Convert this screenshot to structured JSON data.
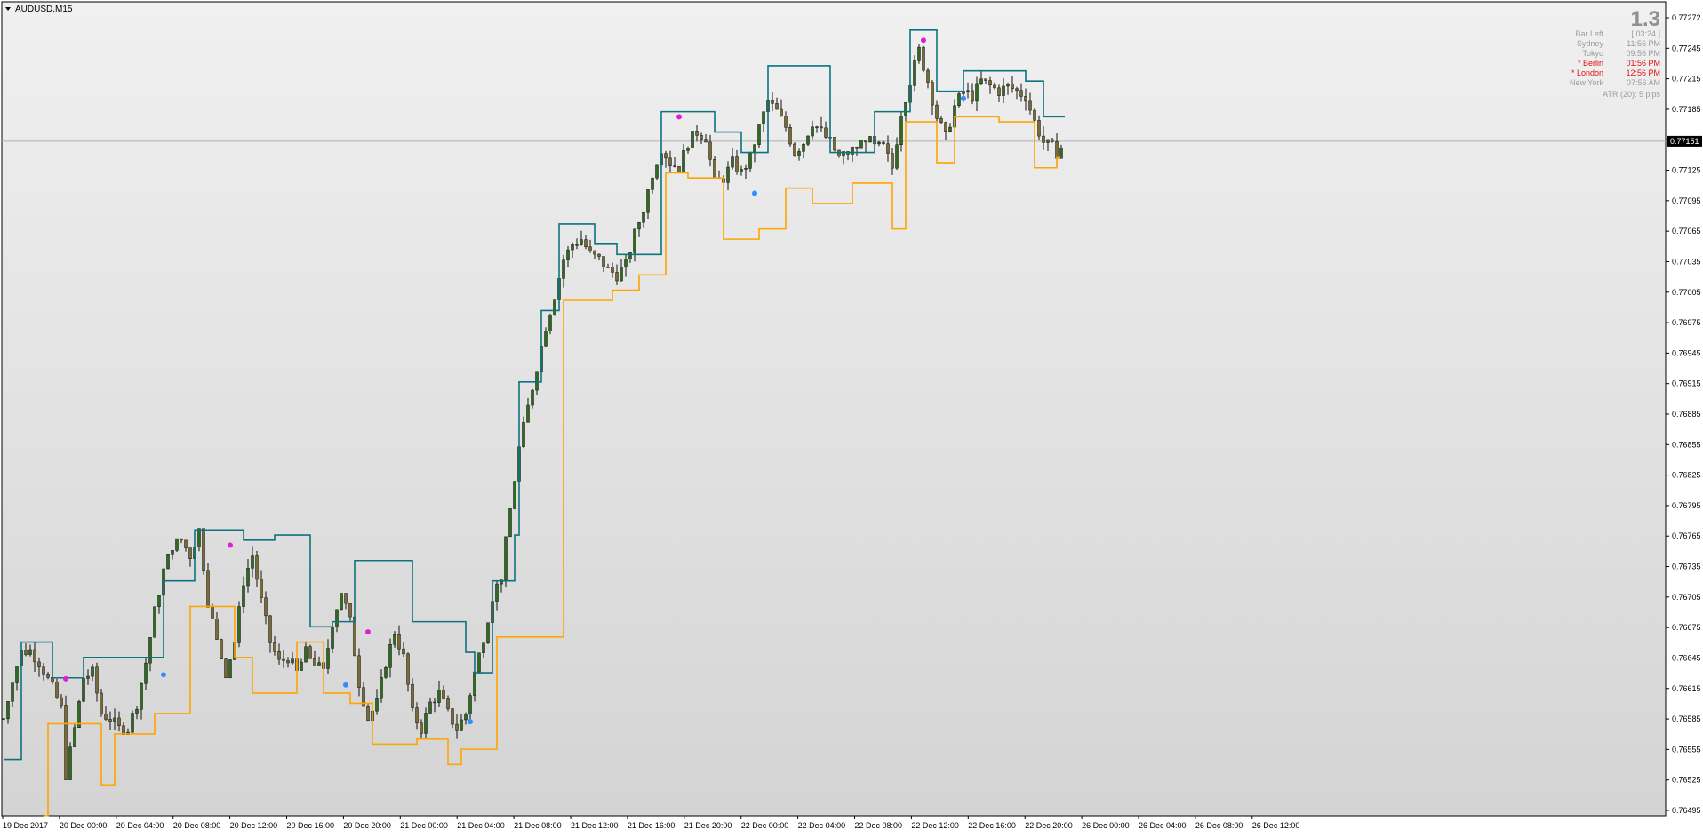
{
  "window": {
    "symbol_label": "AUDUSD,M15",
    "menu_icon": "triangle-down-icon"
  },
  "info_panel": {
    "big_value": "1.3",
    "rows": [
      {
        "label": "Bar Left",
        "value": "[ 03:24 ]",
        "color": "#9a9a9a"
      },
      {
        "label": "Sydney",
        "value": "11:56 PM",
        "color": "#9a9a9a"
      },
      {
        "label": "Tokyo",
        "value": "09:56 PM",
        "color": "#9a9a9a"
      },
      {
        "label": "* Berlin",
        "value": "01:56 PM",
        "color": "#e01010"
      },
      {
        "label": "* London",
        "value": "12:56 PM",
        "color": "#e01010"
      },
      {
        "label": "New York",
        "value": "07:56 AM",
        "color": "#9a9a9a"
      }
    ],
    "atr_text": "ATR (20): 5 pips"
  },
  "colors": {
    "background_top": "#f0f0f0",
    "background_bottom": "#d4d4d4",
    "candle_up": "#2e6b1e",
    "candle_down": "#7a6a35",
    "upper_channel": "#0e7380",
    "lower_channel": "#ffa500",
    "top_marker": "#e020d0",
    "bottom_marker": "#2f8fff",
    "current_price_line": "#b0b0b0",
    "price_label_bg": "#000000",
    "price_label_text": "#ffffff"
  },
  "chart_data": {
    "type": "candlestick",
    "symbol": "AUDUSD",
    "timeframe": "M15",
    "ylim": [
      0.76495,
      0.77272
    ],
    "y_ticks": [
      "0.77272",
      "0.77245",
      "0.77215",
      "0.77185",
      "0.77155",
      "0.77125",
      "0.77095",
      "0.77065",
      "0.77035",
      "0.77005",
      "0.76975",
      "0.76945",
      "0.76915",
      "0.76885",
      "0.76855",
      "0.76825",
      "0.76795",
      "0.76765",
      "0.76735",
      "0.76705",
      "0.76675",
      "0.76645",
      "0.76615",
      "0.76585",
      "0.76555",
      "0.76525",
      "0.76495"
    ],
    "x_ticks": [
      "19 Dec 2017",
      "20 Dec 00:00",
      "20 Dec 04:00",
      "20 Dec 08:00",
      "20 Dec 12:00",
      "20 Dec 16:00",
      "20 Dec 20:00",
      "21 Dec 00:00",
      "21 Dec 04:00",
      "21 Dec 08:00",
      "21 Dec 12:00",
      "21 Dec 16:00",
      "21 Dec 20:00",
      "22 Dec 00:00",
      "22 Dec 04:00",
      "22 Dec 08:00",
      "22 Dec 12:00",
      "22 Dec 16:00",
      "22 Dec 20:00",
      "26 Dec 00:00",
      "26 Dec 04:00",
      "26 Dec 08:00",
      "26 Dec 12:00"
    ],
    "current_price": 0.77151,
    "current_price_label": "0.77151",
    "close_trend": [
      [
        0,
        0.76585
      ],
      [
        2,
        0.76625
      ],
      [
        4,
        0.7665
      ],
      [
        6,
        0.76652
      ],
      [
        8,
        0.7664
      ],
      [
        11,
        0.76615
      ],
      [
        13,
        0.76595
      ],
      [
        14,
        0.7653
      ],
      [
        16,
        0.76575
      ],
      [
        18,
        0.76625
      ],
      [
        20,
        0.7663
      ],
      [
        22,
        0.7659
      ],
      [
        24,
        0.76585
      ],
      [
        26,
        0.76575
      ],
      [
        28,
        0.76575
      ],
      [
        30,
        0.766
      ],
      [
        32,
        0.7664
      ],
      [
        34,
        0.7669
      ],
      [
        36,
        0.7673
      ],
      [
        38,
        0.76755
      ],
      [
        40,
        0.7676
      ],
      [
        42,
        0.76745
      ],
      [
        44,
        0.7677
      ],
      [
        46,
        0.767
      ],
      [
        48,
        0.7666
      ],
      [
        50,
        0.7663
      ],
      [
        52,
        0.7666
      ],
      [
        54,
        0.7672
      ],
      [
        56,
        0.76745
      ],
      [
        58,
        0.767
      ],
      [
        60,
        0.7666
      ],
      [
        62,
        0.7664
      ],
      [
        64,
        0.76645
      ],
      [
        66,
        0.7663
      ],
      [
        68,
        0.7665
      ],
      [
        70,
        0.7664
      ],
      [
        72,
        0.7663
      ],
      [
        74,
        0.7668
      ],
      [
        76,
        0.7671
      ],
      [
        78,
        0.7668
      ],
      [
        80,
        0.7662
      ],
      [
        82,
        0.76585
      ],
      [
        84,
        0.766
      ],
      [
        86,
        0.7664
      ],
      [
        88,
        0.7667
      ],
      [
        90,
        0.76645
      ],
      [
        92,
        0.7659
      ],
      [
        94,
        0.76575
      ],
      [
        96,
        0.766
      ],
      [
        98,
        0.7661
      ],
      [
        100,
        0.7659
      ],
      [
        102,
        0.76575
      ],
      [
        104,
        0.7659
      ],
      [
        106,
        0.7663
      ],
      [
        108,
        0.76665
      ],
      [
        110,
        0.76705
      ],
      [
        112,
        0.76725
      ],
      [
        114,
        0.7679
      ],
      [
        116,
        0.7685
      ],
      [
        118,
        0.7689
      ],
      [
        120,
        0.7693
      ],
      [
        122,
        0.7697
      ],
      [
        124,
        0.77
      ],
      [
        126,
        0.77035
      ],
      [
        128,
        0.7705
      ],
      [
        130,
        0.77055
      ],
      [
        132,
        0.7704
      ],
      [
        134,
        0.77035
      ],
      [
        136,
        0.77025
      ],
      [
        138,
        0.7702
      ],
      [
        140,
        0.7703
      ],
      [
        142,
        0.7706
      ],
      [
        144,
        0.77085
      ],
      [
        146,
        0.7712
      ],
      [
        148,
        0.77145
      ],
      [
        150,
        0.7713
      ],
      [
        152,
        0.77125
      ],
      [
        154,
        0.7715
      ],
      [
        156,
        0.7716
      ],
      [
        158,
        0.77155
      ],
      [
        160,
        0.7711
      ],
      [
        162,
        0.77115
      ],
      [
        164,
        0.7713
      ],
      [
        166,
        0.7712
      ],
      [
        168,
        0.77135
      ],
      [
        170,
        0.77165
      ],
      [
        172,
        0.7719
      ],
      [
        174,
        0.7718
      ],
      [
        176,
        0.77165
      ],
      [
        178,
        0.7714
      ],
      [
        180,
        0.7715
      ],
      [
        182,
        0.7717
      ],
      [
        184,
        0.7716
      ],
      [
        186,
        0.7715
      ],
      [
        188,
        0.77135
      ],
      [
        190,
        0.7714
      ],
      [
        192,
        0.77145
      ],
      [
        194,
        0.77155
      ],
      [
        196,
        0.77145
      ],
      [
        198,
        0.77145
      ],
      [
        200,
        0.77125
      ],
      [
        202,
        0.7718
      ],
      [
        204,
        0.7721
      ],
      [
        206,
        0.7724
      ],
      [
        208,
        0.7721
      ],
      [
        210,
        0.77175
      ],
      [
        212,
        0.77155
      ],
      [
        214,
        0.77185
      ],
      [
        216,
        0.772
      ],
      [
        218,
        0.77195
      ],
      [
        220,
        0.7721
      ],
      [
        222,
        0.77205
      ],
      [
        224,
        0.772
      ],
      [
        226,
        0.77205
      ],
      [
        228,
        0.772
      ],
      [
        230,
        0.77195
      ],
      [
        232,
        0.7717
      ],
      [
        234,
        0.7715
      ],
      [
        236,
        0.77145
      ],
      [
        237,
        0.7714
      ],
      [
        238,
        0.77145
      ]
    ],
    "upper_channel": [
      [
        0,
        0.76545
      ],
      [
        4,
        0.7666
      ],
      [
        11,
        0.76625
      ],
      [
        18,
        0.76645
      ],
      [
        36,
        0.7672
      ],
      [
        43,
        0.7677
      ],
      [
        54,
        0.7676
      ],
      [
        61,
        0.76765
      ],
      [
        69,
        0.76675
      ],
      [
        74,
        0.7668
      ],
      [
        79,
        0.7674
      ],
      [
        92,
        0.7668
      ],
      [
        104,
        0.7665
      ],
      [
        106,
        0.7663
      ],
      [
        110,
        0.7672
      ],
      [
        115,
        0.76765
      ],
      [
        116,
        0.76915
      ],
      [
        121,
        0.76985
      ],
      [
        125,
        0.7707
      ],
      [
        133,
        0.7705
      ],
      [
        138,
        0.7704
      ],
      [
        148,
        0.7718
      ],
      [
        160,
        0.7716
      ],
      [
        166,
        0.7714
      ],
      [
        172,
        0.77225
      ],
      [
        186,
        0.7714
      ],
      [
        196,
        0.7718
      ],
      [
        204,
        0.7726
      ],
      [
        210,
        0.772
      ],
      [
        216,
        0.7722
      ],
      [
        230,
        0.7721
      ],
      [
        234,
        0.77175
      ],
      [
        238,
        0.77175
      ]
    ],
    "lower_channel": [
      [
        9,
        0.7649
      ],
      [
        10,
        0.7658
      ],
      [
        22,
        0.7652
      ],
      [
        25,
        0.7657
      ],
      [
        34,
        0.7659
      ],
      [
        42,
        0.76695
      ],
      [
        52,
        0.76645
      ],
      [
        56,
        0.7661
      ],
      [
        66,
        0.7666
      ],
      [
        72,
        0.7661
      ],
      [
        78,
        0.766
      ],
      [
        83,
        0.7656
      ],
      [
        93,
        0.76565
      ],
      [
        100,
        0.7654
      ],
      [
        103,
        0.76555
      ],
      [
        111,
        0.76665
      ],
      [
        126,
        0.76995
      ],
      [
        137,
        0.77005
      ],
      [
        143,
        0.7702
      ],
      [
        149,
        0.7712
      ],
      [
        154,
        0.77115
      ],
      [
        162,
        0.77055
      ],
      [
        170,
        0.77065
      ],
      [
        176,
        0.77105
      ],
      [
        182,
        0.7709
      ],
      [
        191,
        0.7711
      ],
      [
        200,
        0.77065
      ],
      [
        203,
        0.7717
      ],
      [
        210,
        0.7713
      ],
      [
        214,
        0.77175
      ],
      [
        224,
        0.7717
      ],
      [
        232,
        0.77125
      ],
      [
        237,
        0.77135
      ]
    ],
    "top_markers": [
      [
        14,
        0.76624
      ],
      [
        51,
        0.76755
      ],
      [
        82,
        0.7667
      ],
      [
        152,
        0.77175
      ],
      [
        207,
        0.7725
      ]
    ],
    "bottom_markers": [
      [
        36,
        0.76628
      ],
      [
        77,
        0.76618
      ],
      [
        105,
        0.76582
      ],
      [
        169,
        0.771
      ],
      [
        216,
        0.77193
      ]
    ]
  }
}
